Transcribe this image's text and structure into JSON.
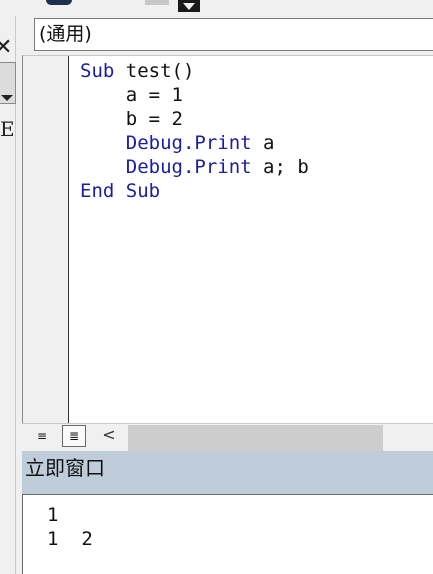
{
  "code_window": {
    "object_combo": "(通用)",
    "lines": [
      [
        {
          "t": "Sub",
          "kw": true
        },
        {
          "t": " test()",
          "kw": false
        }
      ],
      [
        {
          "t": "    a = 1",
          "kw": false
        }
      ],
      [
        {
          "t": "    b = 2",
          "kw": false
        }
      ],
      [
        {
          "t": "    Debug.Print",
          "kw": true
        },
        {
          "t": " a",
          "kw": false
        }
      ],
      [
        {
          "t": "    Debug.Print",
          "kw": true
        },
        {
          "t": " a; b",
          "kw": false
        }
      ],
      [
        {
          "t": "End Sub",
          "kw": true
        }
      ]
    ],
    "keyword_color": "#1a1ea0",
    "view_procedure_icon": "≡",
    "view_full_module_icon": "≣",
    "scroll_left_icon": "<"
  },
  "immediate_window": {
    "title": "立即窗口",
    "title_bar_color": "#bfcddb",
    "output": [
      "1",
      "1  2"
    ]
  },
  "left_panel": {
    "partial_text": "E"
  }
}
